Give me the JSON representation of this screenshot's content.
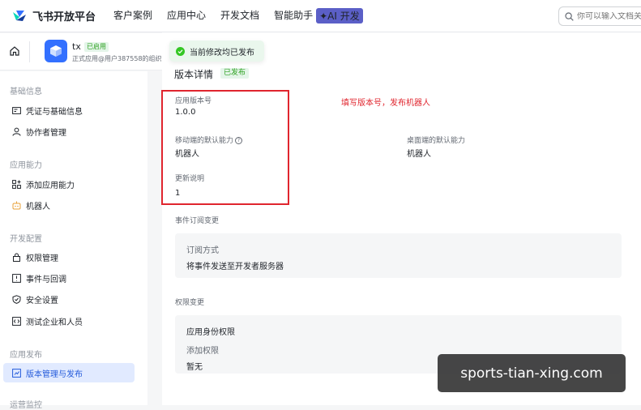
{
  "header": {
    "brand": "飞书开放平台",
    "nav": [
      "客户案例",
      "应用中心",
      "开发文档",
      "智能助手"
    ],
    "ai_badge": "✦AI 开发",
    "search_placeholder": "你可以输入文档关"
  },
  "app": {
    "name": "tx",
    "status": "已启用",
    "description": "正式应用@用户387558的组织"
  },
  "sidebar": {
    "sections": [
      {
        "title": "基础信息",
        "items": [
          "凭证与基础信息",
          "协作者管理"
        ]
      },
      {
        "title": "应用能力",
        "items": [
          "添加应用能力",
          "机器人"
        ]
      },
      {
        "title": "开发配置",
        "items": [
          "权限管理",
          "事件与回调",
          "安全设置",
          "测试企业和人员"
        ]
      },
      {
        "title": "应用发布",
        "items": [
          "版本管理与发布"
        ]
      },
      {
        "title": "运营监控",
        "items": []
      }
    ]
  },
  "toast": "当前修改均已发布",
  "detail": {
    "title": "版本详情",
    "status": "已发布",
    "version_label": "应用版本号",
    "version_value": "1.0.0",
    "mobile_label": "移动端的默认能力",
    "mobile_value": "机器人",
    "desktop_label": "桌面端的默认能力",
    "desktop_value": "机器人",
    "notes_label": "更新说明",
    "notes_value": "1"
  },
  "annotation": "填写版本号，发布机器人",
  "events": {
    "section_title": "事件订阅变更",
    "method_label": "订阅方式",
    "method_value": "将事件发送至开发者服务器"
  },
  "permissions": {
    "section_title": "权限变更",
    "identity_label": "应用身份权限",
    "added_label": "添加权限",
    "added_value": "暂无"
  },
  "watermark": "sports-tian-xing.com",
  "colors": {
    "accent": "#3370ff",
    "annotation": "#e0252e",
    "success": "#34c724"
  }
}
